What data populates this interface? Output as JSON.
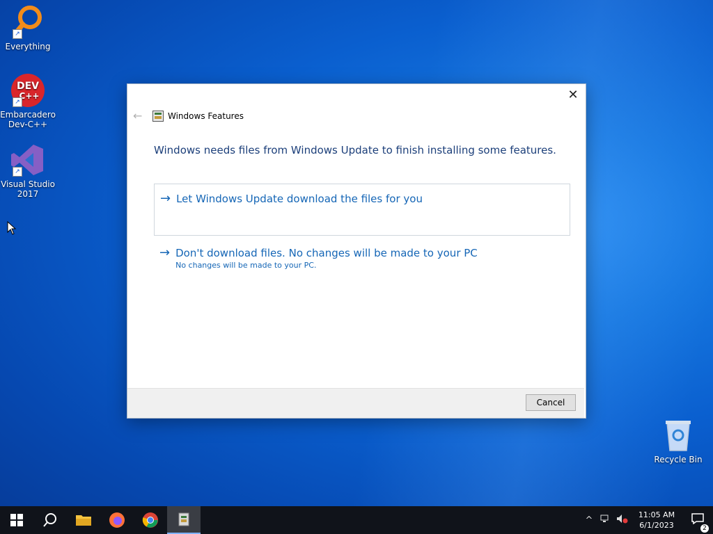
{
  "desktop": {
    "icons": [
      {
        "label": "Everything"
      },
      {
        "label": "Embarcadero Dev-C++"
      },
      {
        "label": "Visual Studio 2017"
      },
      {
        "label": "Recycle Bin"
      }
    ],
    "devcpp_badge_text": "DEV C++"
  },
  "dialog": {
    "title": "Windows Features",
    "instruction": "Windows needs files from Windows Update to finish installing some features.",
    "options": [
      {
        "label": "Let Windows Update download the files for you"
      },
      {
        "label": "Don't download files. No changes will be made to your PC",
        "sublabel": "No changes will be made to your PC."
      }
    ],
    "cancel_label": "Cancel",
    "close_glyph": "✕",
    "back_glyph": "←",
    "option_arrow_glyph": "→"
  },
  "taskbar": {
    "clock_time": "11:05 AM",
    "clock_date": "6/1/2023",
    "notification_count": "2",
    "tray_chevron": "^"
  },
  "colors": {
    "accent_link": "#1566b6",
    "instruction_text": "#1c3f7a",
    "taskbar_bg": "#10131a"
  }
}
